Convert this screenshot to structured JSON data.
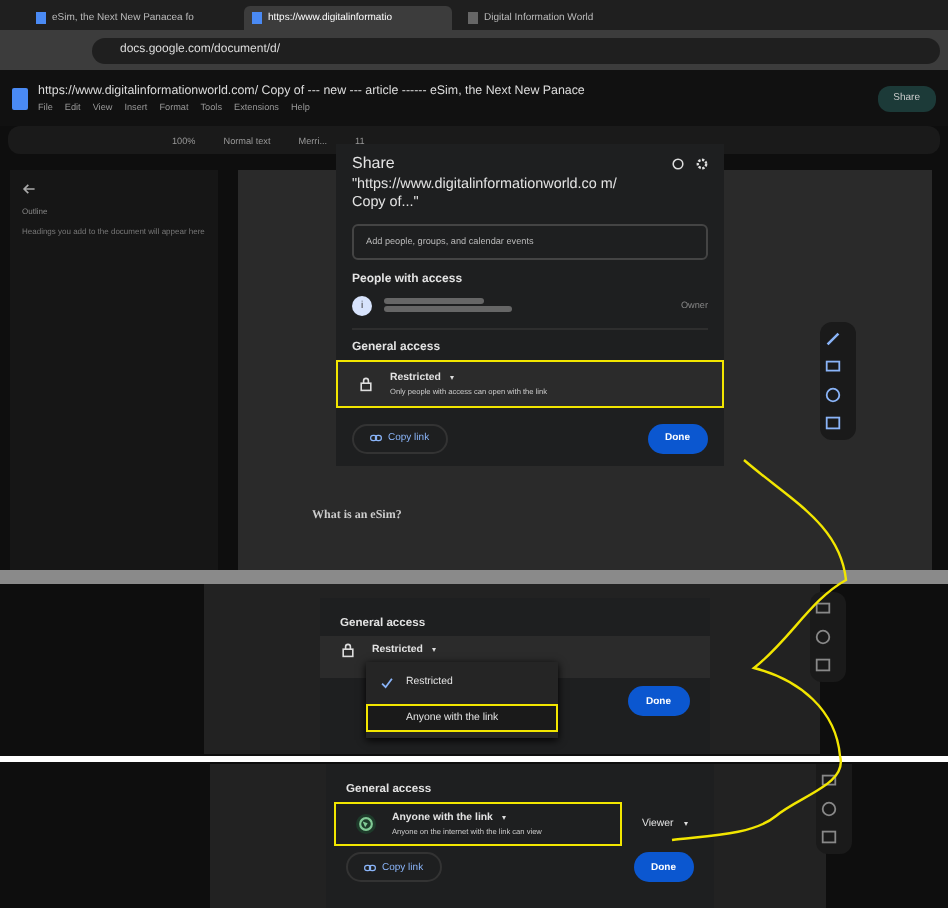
{
  "browser": {
    "tabs": [
      {
        "title": "eSim, the Next New Panacea fo",
        "selected": false
      },
      {
        "title": "https://www.digitalinformatio",
        "selected": true
      },
      {
        "title": "Digital Information World",
        "selected": false
      }
    ],
    "address": "docs.google.com/document/d/"
  },
  "doc": {
    "title": "https://www.digitalinformationworld.com/ Copy of --- new --- article ------ eSim, the Next New Panace",
    "menu": [
      "File",
      "Edit",
      "View",
      "Insert",
      "Format",
      "Tools",
      "Extensions",
      "Help"
    ],
    "share": "Share",
    "toolbar": [
      "100%",
      "Normal text",
      "Merri...",
      "11"
    ],
    "outline_heading": "Outline",
    "outline_hint": "Headings you add to the document will appear here",
    "section_heading": "What is an eSim?"
  },
  "share_dialog": {
    "title": "Share",
    "doc_name": "\"https://www.digitalinformationworld.co m/ Copy of...\"",
    "add_placeholder": "Add people, groups, and calendar events",
    "people_heading": "People with access",
    "people": [
      {
        "avatar": "i",
        "role": "Owner"
      }
    ],
    "general_heading": "General access",
    "access": "Restricted",
    "access_description": "Only people with access can open with the link",
    "highlighted": true,
    "copy_link": "Copy link",
    "done": "Done"
  },
  "step_menu": {
    "general_heading": "General access",
    "access": "Restricted",
    "options": [
      {
        "label": "Restricted",
        "selected": true,
        "highlighted": false
      },
      {
        "label": "Anyone with the link",
        "selected": false,
        "highlighted": true
      }
    ],
    "done": "Done"
  },
  "step_result": {
    "general_heading": "General access",
    "access": "Anyone with the link",
    "access_description": "Anyone on the internet with the link can view",
    "highlighted": true,
    "role": "Viewer",
    "copy_link": "Copy link",
    "done": "Done"
  }
}
